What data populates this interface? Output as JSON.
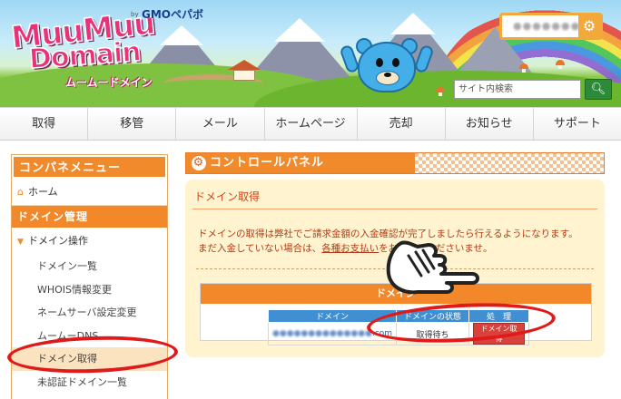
{
  "header": {
    "logo_line1": "MuuMuu",
    "logo_line2": "Domain",
    "logo_kana": "ムームードメイン",
    "gmo_by": "by",
    "gmo_brand": "GMOペパボ",
    "user_name": "●●●●●●●●",
    "gear_icon": "gear-icon",
    "search": {
      "placeholder": "サイト内検索",
      "button_icon": "search-icon"
    }
  },
  "nav": {
    "items": [
      {
        "label": "取得"
      },
      {
        "label": "移管"
      },
      {
        "label": "メール"
      },
      {
        "label": "ホームページ"
      },
      {
        "label": "売却"
      },
      {
        "label": "お知らせ"
      },
      {
        "label": "サポート"
      }
    ]
  },
  "sidebar": {
    "title": "コンパネメニュー",
    "home": "ホーム",
    "section": "ドメイン管理",
    "group": "ドメイン操作",
    "links": [
      {
        "label": "ドメイン一覧"
      },
      {
        "label": "WHOIS情報変更"
      },
      {
        "label": "ネームサーバ設定変更"
      },
      {
        "label": "ムームーDNS"
      },
      {
        "label": "ドメイン取得"
      },
      {
        "label": "未認証ドメイン一覧"
      }
    ]
  },
  "main": {
    "control_panel_title": "コントロールパネル",
    "panel_title": "ドメイン取得",
    "message_line1": "ドメインの取得は弊社でご請求金額の入金確認が完了しましたら行えるようになります。",
    "message_line2_pre": "まだ入金していない場合は、",
    "message_line2_link": "各種お支払い",
    "message_line2_post": "をお済ませくださいませ。",
    "table_title": "ドメイン",
    "table": {
      "headers": [
        "ドメイン",
        "ドメインの状態",
        "処　理"
      ],
      "rows": [
        {
          "domain_blurred": "●●●●●●●●●●●●●●",
          "domain_suffix": ".com",
          "status": "取得待ち",
          "action": "ドメイン取得"
        }
      ]
    }
  },
  "colors": {
    "accent_orange": "#f08a2a",
    "panel_bg": "#fff4cf",
    "header_blue": "#3f8fd2",
    "annotation_red": "#e01a1a",
    "search_green": "#2d8a39"
  }
}
